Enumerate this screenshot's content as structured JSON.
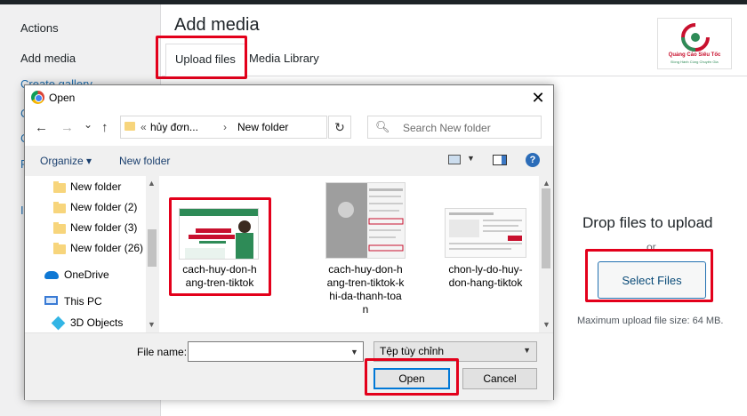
{
  "wp": {
    "sidebar": {
      "actions_label": "Actions",
      "add_media_label": "Add media",
      "create_gallery_label": "Create gallery",
      "frag_c1": "C",
      "frag_c2": "C",
      "frag_f": "F",
      "frag_i": "I"
    },
    "title": "Add media",
    "tabs": {
      "upload": "Upload files",
      "library": "Media Library"
    },
    "logo": {
      "name": "Quảng Cáo Siêu Tốc",
      "tagline": "Đồng Hành Cùng Chuyên Gia"
    },
    "uploader": {
      "drop_title": "Drop files to upload",
      "or": "or",
      "select_button": "Select Files",
      "max_size": "Maximum upload file size: 64 MB."
    }
  },
  "dialog": {
    "title": "Open",
    "close": "✕",
    "nav": {
      "back": "←",
      "forward": "→",
      "dropdown": "⌄",
      "up": "↑"
    },
    "address": {
      "overflow": "«",
      "crumb1": "hủy đơn...",
      "sep": "›",
      "crumb2": "New folder",
      "dropdown": "⌄",
      "refresh": "↻"
    },
    "search_placeholder": "Search New folder",
    "toolbar": {
      "organize": "Organize ▾",
      "new_folder": "New folder",
      "help": "?"
    },
    "nav_pane": {
      "items": [
        "New folder",
        "New folder (2)",
        "New folder (3)",
        "New folder (26)"
      ],
      "onedrive": "OneDrive",
      "this_pc": "This PC",
      "objects": "3D Objects"
    },
    "files": [
      {
        "label": "cach-huy-don-h\nang-tren-tiktok"
      },
      {
        "label": "cach-huy-don-h\nang-tren-tiktok-k\nhi-da-thanh-toa\nn"
      },
      {
        "label": "chon-ly-do-huy-\ndon-hang-tiktok"
      }
    ],
    "thumb1_text": {
      "line1": "CÁCH HỦY",
      "line2": "ĐƠN HÀNG TRÊN TIKTOK"
    },
    "file_name_label": "File name:",
    "file_name_value": "",
    "file_type": "Tệp tùy chỉnh",
    "open_button": "Open",
    "cancel_button": "Cancel"
  },
  "colors": {
    "highlight": "#e3001b",
    "wp_link": "#2271b1",
    "win_accent": "#0078d7"
  }
}
